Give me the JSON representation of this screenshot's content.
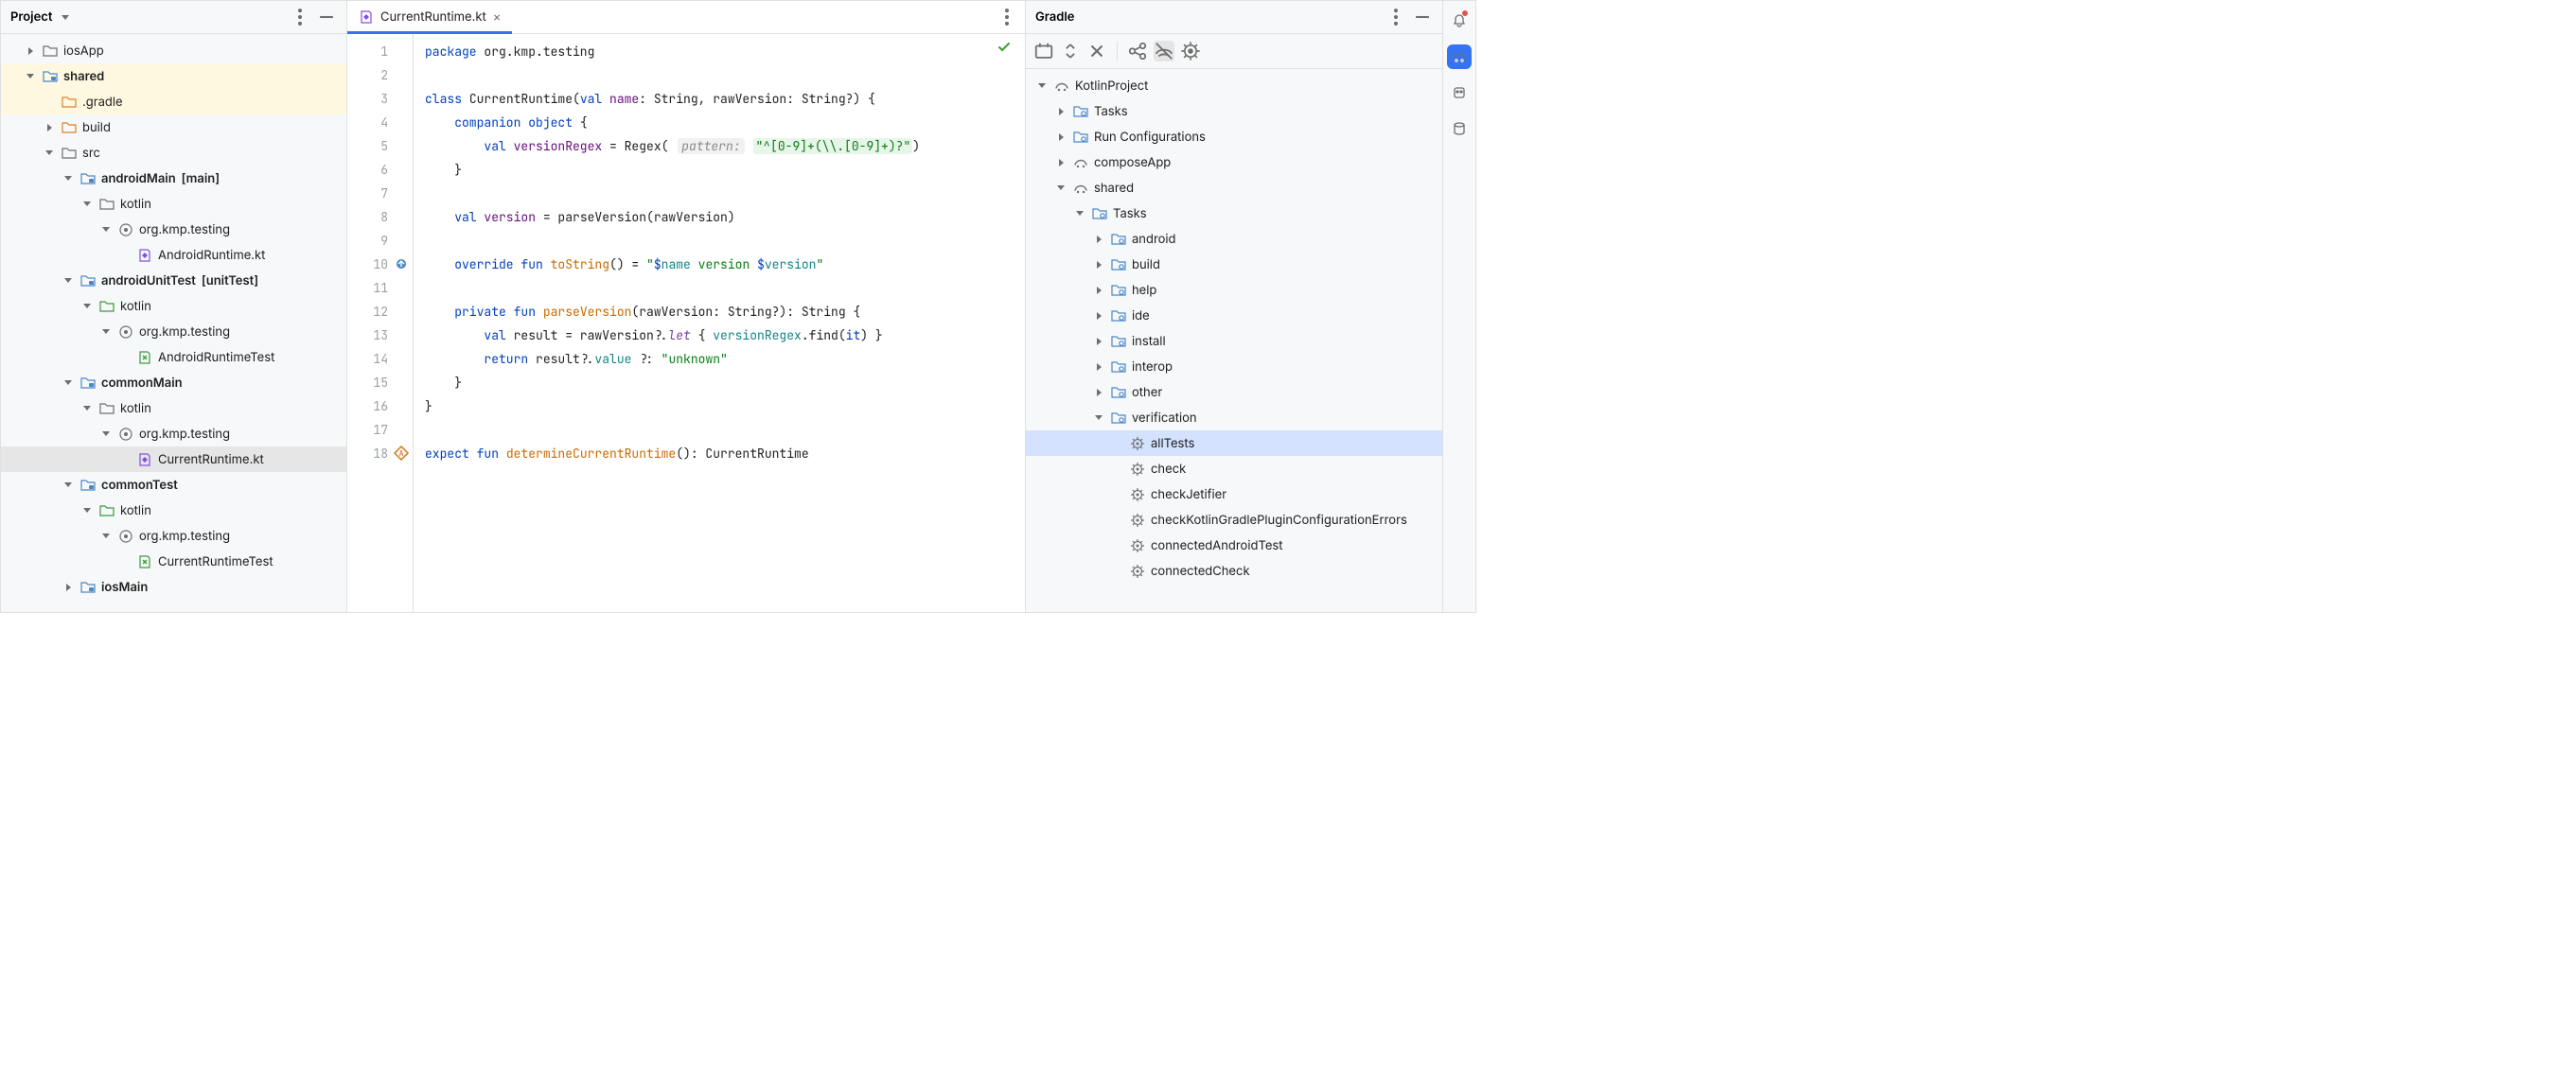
{
  "project": {
    "header": "Project",
    "tree": [
      {
        "depth": 0,
        "twist": "right",
        "icon": "folder",
        "label": "iosApp"
      },
      {
        "depth": 0,
        "twist": "down",
        "icon": "module",
        "label": "shared",
        "bold": true,
        "state": "highlight"
      },
      {
        "depth": 1,
        "twist": "none",
        "icon": "folder-orange",
        "label": ".gradle",
        "state": "highlight"
      },
      {
        "depth": 1,
        "twist": "right",
        "icon": "folder-orange",
        "label": "build"
      },
      {
        "depth": 1,
        "twist": "down",
        "icon": "folder",
        "label": "src"
      },
      {
        "depth": 2,
        "twist": "down",
        "icon": "module",
        "label": "androidMain",
        "suffix": "[main]",
        "bold": true
      },
      {
        "depth": 3,
        "twist": "down",
        "icon": "folder",
        "label": "kotlin"
      },
      {
        "depth": 4,
        "twist": "down",
        "icon": "package",
        "label": "org.kmp.testing"
      },
      {
        "depth": 5,
        "twist": "none",
        "icon": "kt",
        "label": "AndroidRuntime.kt"
      },
      {
        "depth": 2,
        "twist": "down",
        "icon": "module",
        "label": "androidUnitTest",
        "suffix": "[unitTest]",
        "bold": true
      },
      {
        "depth": 3,
        "twist": "down",
        "icon": "folder-green",
        "label": "kotlin"
      },
      {
        "depth": 4,
        "twist": "down",
        "icon": "package",
        "label": "org.kmp.testing"
      },
      {
        "depth": 5,
        "twist": "none",
        "icon": "kt-test",
        "label": "AndroidRuntimeTest"
      },
      {
        "depth": 2,
        "twist": "down",
        "icon": "module",
        "label": "commonMain",
        "bold": true
      },
      {
        "depth": 3,
        "twist": "down",
        "icon": "folder",
        "label": "kotlin"
      },
      {
        "depth": 4,
        "twist": "down",
        "icon": "package",
        "label": "org.kmp.testing"
      },
      {
        "depth": 5,
        "twist": "none",
        "icon": "kt",
        "label": "CurrentRuntime.kt",
        "state": "selected"
      },
      {
        "depth": 2,
        "twist": "down",
        "icon": "module",
        "label": "commonTest",
        "bold": true
      },
      {
        "depth": 3,
        "twist": "down",
        "icon": "folder-green",
        "label": "kotlin"
      },
      {
        "depth": 4,
        "twist": "down",
        "icon": "package",
        "label": "org.kmp.testing"
      },
      {
        "depth": 5,
        "twist": "none",
        "icon": "kt-test",
        "label": "CurrentRuntimeTest"
      },
      {
        "depth": 2,
        "twist": "right",
        "icon": "module",
        "label": "iosMain",
        "bold": true
      }
    ]
  },
  "editor": {
    "tab": {
      "label": "CurrentRuntime.kt"
    },
    "inspection_ok": true,
    "lines": [
      {
        "n": 1,
        "tokens": [
          {
            "t": "package ",
            "c": "kw"
          },
          {
            "t": "org.kmp.testing"
          }
        ]
      },
      {
        "n": 2,
        "tokens": []
      },
      {
        "n": 3,
        "tokens": [
          {
            "t": "class ",
            "c": "kw"
          },
          {
            "t": "CurrentRuntime("
          },
          {
            "t": "val ",
            "c": "kw"
          },
          {
            "t": "name",
            "c": "decl"
          },
          {
            "t": ": String, rawVersion: String?) {"
          }
        ]
      },
      {
        "n": 4,
        "tokens": [
          {
            "t": "    "
          },
          {
            "t": "companion object ",
            "c": "kw"
          },
          {
            "t": "{"
          }
        ]
      },
      {
        "n": 5,
        "tokens": [
          {
            "t": "        "
          },
          {
            "t": "val ",
            "c": "kw"
          },
          {
            "t": "versionRegex",
            "c": "decl"
          },
          {
            "t": " = Regex( "
          },
          {
            "t": "pattern:",
            "c": "hint"
          },
          {
            "t": " "
          },
          {
            "t": "\"^[0-9]+(\\\\.[0-9]+)?\"",
            "c": "str str-bg"
          },
          {
            "t": ")"
          }
        ]
      },
      {
        "n": 6,
        "tokens": [
          {
            "t": "    }"
          }
        ]
      },
      {
        "n": 7,
        "tokens": []
      },
      {
        "n": 8,
        "tokens": [
          {
            "t": "    "
          },
          {
            "t": "val ",
            "c": "kw"
          },
          {
            "t": "version",
            "c": "decl"
          },
          {
            "t": " = parseVersion(rawVersion)"
          }
        ]
      },
      {
        "n": 9,
        "tokens": []
      },
      {
        "n": 10,
        "gicon": "override",
        "tokens": [
          {
            "t": "    "
          },
          {
            "t": "override fun ",
            "c": "kw"
          },
          {
            "t": "toString",
            "c": "orange"
          },
          {
            "t": "() = "
          },
          {
            "t": "\"",
            "c": "str"
          },
          {
            "t": "$",
            "c": "kw"
          },
          {
            "t": "name",
            "c": "teal"
          },
          {
            "t": " version ",
            "c": "str"
          },
          {
            "t": "$",
            "c": "kw"
          },
          {
            "t": "version",
            "c": "teal"
          },
          {
            "t": "\"",
            "c": "str"
          }
        ]
      },
      {
        "n": 11,
        "tokens": []
      },
      {
        "n": 12,
        "tokens": [
          {
            "t": "    "
          },
          {
            "t": "private fun ",
            "c": "kw"
          },
          {
            "t": "parseVersion",
            "c": "orange"
          },
          {
            "t": "(rawVersion: String?): String {"
          }
        ]
      },
      {
        "n": 13,
        "tokens": [
          {
            "t": "        "
          },
          {
            "t": "val ",
            "c": "kw"
          },
          {
            "t": "result = rawVersion?."
          },
          {
            "t": "let",
            "c": "purple"
          },
          {
            "t": " { "
          },
          {
            "t": "versionRegex",
            "c": "teal"
          },
          {
            "t": ".find("
          },
          {
            "t": "it",
            "c": "kw"
          },
          {
            "t": ") }"
          }
        ]
      },
      {
        "n": 14,
        "tokens": [
          {
            "t": "        "
          },
          {
            "t": "return ",
            "c": "kw"
          },
          {
            "t": "result?."
          },
          {
            "t": "value",
            "c": "teal"
          },
          {
            "t": " ?: "
          },
          {
            "t": "\"unknown\"",
            "c": "str"
          }
        ]
      },
      {
        "n": 15,
        "tokens": [
          {
            "t": "    }"
          }
        ]
      },
      {
        "n": 16,
        "tokens": [
          {
            "t": "}"
          }
        ]
      },
      {
        "n": 17,
        "tokens": []
      },
      {
        "n": 18,
        "gicon": "actual",
        "tokens": [
          {
            "t": "expect fun ",
            "c": "kw"
          },
          {
            "t": "determineCurrentRuntime",
            "c": "orange"
          },
          {
            "t": "(): CurrentRuntime"
          }
        ]
      }
    ]
  },
  "gradle": {
    "header": "Gradle",
    "tree": [
      {
        "depth": 0,
        "twist": "down",
        "icon": "gradle",
        "label": "KotlinProject"
      },
      {
        "depth": 1,
        "twist": "right",
        "icon": "tasks",
        "label": "Tasks"
      },
      {
        "depth": 1,
        "twist": "right",
        "icon": "tasks",
        "label": "Run Configurations"
      },
      {
        "depth": 1,
        "twist": "right",
        "icon": "gradle",
        "label": "composeApp"
      },
      {
        "depth": 1,
        "twist": "down",
        "icon": "gradle",
        "label": "shared"
      },
      {
        "depth": 2,
        "twist": "down",
        "icon": "tasks",
        "label": "Tasks"
      },
      {
        "depth": 3,
        "twist": "right",
        "icon": "tasks",
        "label": "android"
      },
      {
        "depth": 3,
        "twist": "right",
        "icon": "tasks",
        "label": "build"
      },
      {
        "depth": 3,
        "twist": "right",
        "icon": "tasks",
        "label": "help"
      },
      {
        "depth": 3,
        "twist": "right",
        "icon": "tasks",
        "label": "ide"
      },
      {
        "depth": 3,
        "twist": "right",
        "icon": "tasks",
        "label": "install"
      },
      {
        "depth": 3,
        "twist": "right",
        "icon": "tasks",
        "label": "interop"
      },
      {
        "depth": 3,
        "twist": "right",
        "icon": "tasks",
        "label": "other"
      },
      {
        "depth": 3,
        "twist": "down",
        "icon": "tasks",
        "label": "verification"
      },
      {
        "depth": 4,
        "twist": "none",
        "icon": "gear",
        "label": "allTests",
        "state": "sel-blue"
      },
      {
        "depth": 4,
        "twist": "none",
        "icon": "gear",
        "label": "check"
      },
      {
        "depth": 4,
        "twist": "none",
        "icon": "gear",
        "label": "checkJetifier"
      },
      {
        "depth": 4,
        "twist": "none",
        "icon": "gear",
        "label": "checkKotlinGradlePluginConfigurationErrors"
      },
      {
        "depth": 4,
        "twist": "none",
        "icon": "gear",
        "label": "connectedAndroidTest"
      },
      {
        "depth": 4,
        "twist": "none",
        "icon": "gear",
        "label": "connectedCheck"
      }
    ]
  }
}
